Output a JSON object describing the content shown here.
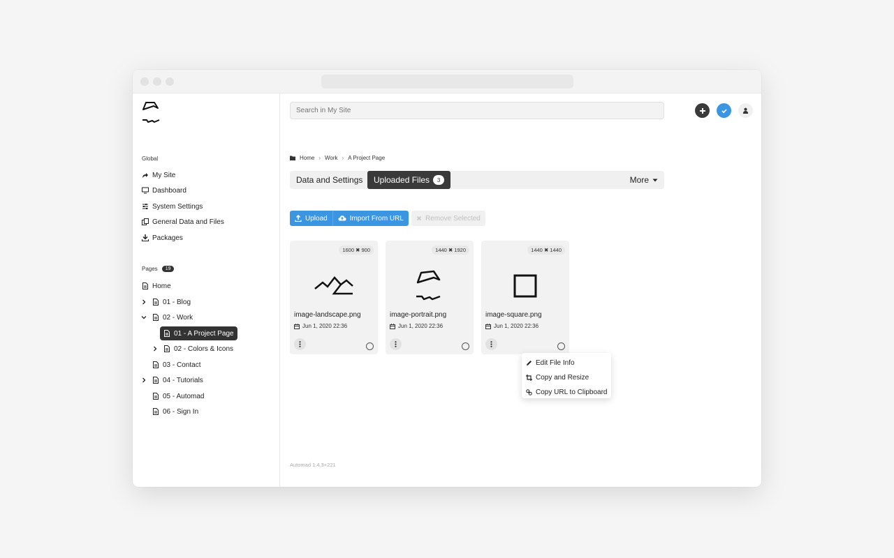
{
  "search": {
    "placeholder": "Search in My Site"
  },
  "sidebar": {
    "global_label": "Global",
    "global_items": [
      {
        "label": "My Site",
        "icon": "share-arrow-icon"
      },
      {
        "label": "Dashboard",
        "icon": "monitor-icon"
      },
      {
        "label": "System Settings",
        "icon": "sliders-icon"
      },
      {
        "label": "General Data and Files",
        "icon": "files-icon"
      },
      {
        "label": "Packages",
        "icon": "download-icon"
      }
    ],
    "pages_label": "Pages",
    "pages_count": "19",
    "tree": [
      {
        "label": "Home"
      },
      {
        "label": "01 - Blog"
      },
      {
        "label": "02 - Work"
      },
      {
        "label": "01 - A Project Page"
      },
      {
        "label": "02 - Colors & Icons"
      },
      {
        "label": "03 - Contact"
      },
      {
        "label": "04 - Tutorials"
      },
      {
        "label": "05 - Automad"
      },
      {
        "label": "06 - Sign In"
      }
    ]
  },
  "breadcrumb": [
    "Home",
    "Work",
    "A Project Page"
  ],
  "tabs": {
    "data_settings": "Data and Settings",
    "uploaded_files": "Uploaded Files",
    "uploaded_count": "3",
    "more": "More"
  },
  "toolbar": {
    "upload": "Upload",
    "import_url": "Import From URL",
    "remove_selected": "Remove Selected"
  },
  "files": [
    {
      "dims": "1600 ✖ 900",
      "name": "image-landscape.png",
      "date": "Jun 1, 2020 22:36"
    },
    {
      "dims": "1440 ✖ 1920",
      "name": "image-portrait.png",
      "date": "Jun 1, 2020 22:36"
    },
    {
      "dims": "1440 ✖ 1440",
      "name": "image-square.png",
      "date": "Jun 1, 2020 22:36"
    }
  ],
  "file_menu": {
    "edit_info": "Edit File Info",
    "copy_resize": "Copy and Resize",
    "copy_url": "Copy URL to Clipboard"
  },
  "version": "Automad 1.4.3+221",
  "colors": {
    "accent": "#3b95e1",
    "dark": "#3a3a3a"
  }
}
